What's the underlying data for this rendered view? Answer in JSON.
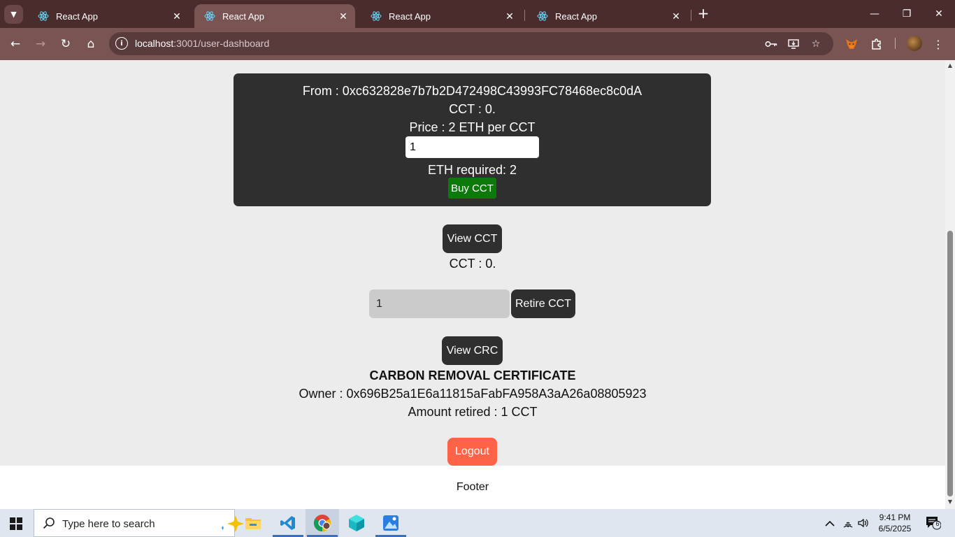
{
  "browser": {
    "tabs": [
      {
        "title": "React App",
        "active": false
      },
      {
        "title": "React App",
        "active": true
      },
      {
        "title": "React App",
        "active": false
      },
      {
        "title": "React App",
        "active": false
      }
    ],
    "url_host": "localhost",
    "url_path": ":3001/user-dashboard"
  },
  "buy_section": {
    "from_line": "From : 0xc632828e7b7b2D472498C43993FC78468ec8c0dA",
    "cct_line": "CCT : 0.",
    "price_line": "Price : 2 ETH per CCT",
    "amount_value": "1",
    "eth_required_line": "ETH required: 2",
    "buy_label": "Buy CCT"
  },
  "view_cct": {
    "button_label": "View CCT",
    "result_line": "CCT : 0."
  },
  "retire": {
    "amount_value": "1",
    "button_label": "Retire CCT"
  },
  "crc": {
    "button_label": "View CRC",
    "heading": "CARBON REMOVAL CERTIFICATE",
    "owner_line": "Owner : 0x696B25a1E6a11815aFabFA958A3aA26a08805923",
    "amount_line": "Amount retired : 1 CCT"
  },
  "logout_label": "Logout",
  "footer_text": "Footer",
  "taskbar": {
    "search_placeholder": "Type here to search",
    "time": "9:41 PM",
    "date": "6/5/2025",
    "notification_count": "6"
  },
  "colors": {
    "tabstrip": "#4a2c2c",
    "toolbar": "#7a5353",
    "card_bg": "#2f2f2f",
    "buy_button": "#0b7a0b",
    "logout_button": "#ff6347"
  }
}
